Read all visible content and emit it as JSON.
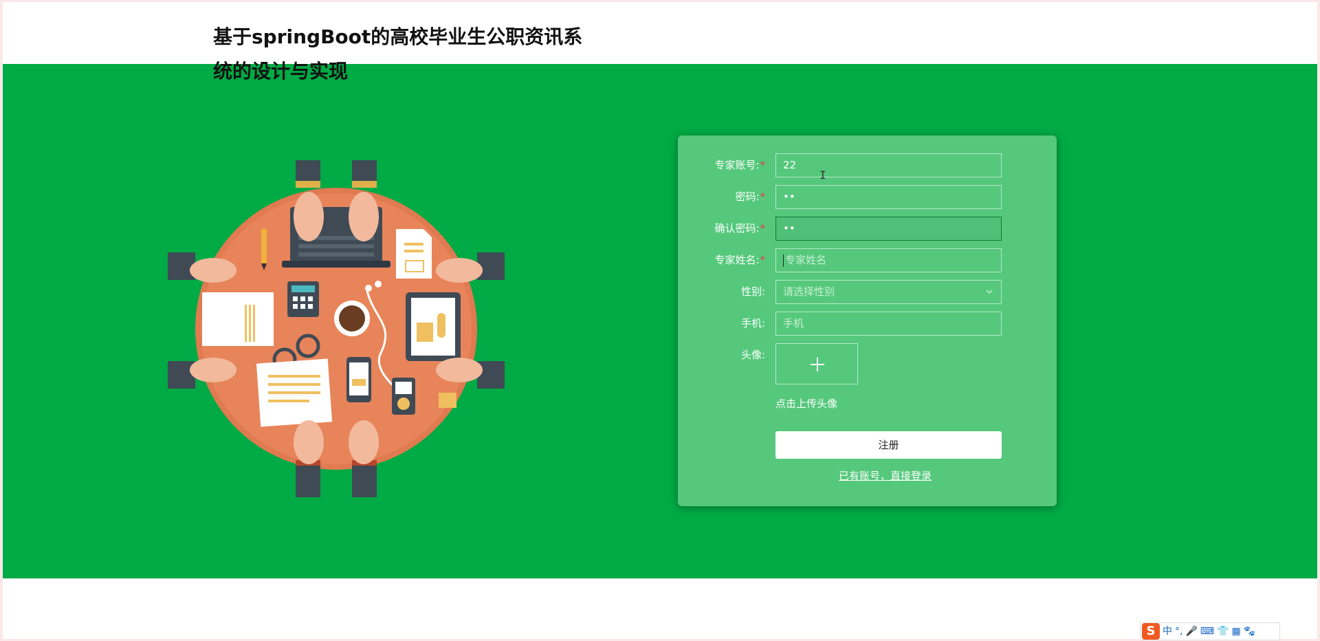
{
  "site": {
    "title": "基于springBoot的高校毕业生公职资讯系统的设计与实现"
  },
  "form": {
    "account": {
      "label": "专家账号:",
      "required": true,
      "value": "22"
    },
    "password": {
      "label": "密码:",
      "required": true,
      "value": "••"
    },
    "confirm_password": {
      "label": "确认密码:",
      "required": true,
      "value": "••"
    },
    "name": {
      "label": "专家姓名:",
      "required": true,
      "placeholder": "专家姓名"
    },
    "gender": {
      "label": "性别:",
      "placeholder": "请选择性别"
    },
    "phone": {
      "label": "手机:",
      "placeholder": "手机"
    },
    "avatar": {
      "label": "头像:",
      "upload_hint": "点击上传头像",
      "icon": "plus-icon"
    },
    "submit_label": "注册",
    "login_link": "已有账号，直接登录"
  },
  "ime_bar": {
    "logo": "S",
    "mode": "中",
    "items": [
      "°,",
      "🎤",
      "⌨",
      "👕",
      "▦",
      "🐾"
    ]
  },
  "colors": {
    "banner": "#00aa44",
    "panel": "#55c87c",
    "required_star": "#e63b3b"
  }
}
